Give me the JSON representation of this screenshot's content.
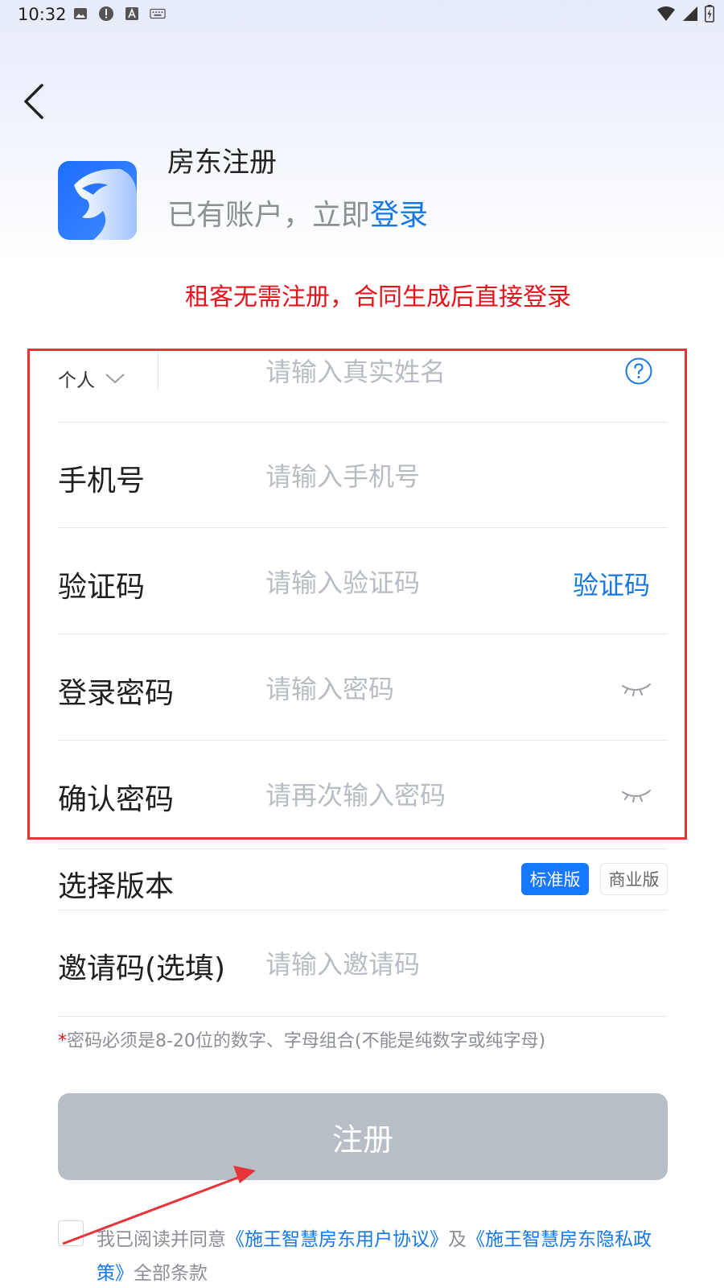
{
  "status_bar": {
    "time": "10:32"
  },
  "header": {
    "title": "房东注册",
    "login_prompt": "已有账户，立即",
    "login_link": "登录"
  },
  "notice": "租客无需注册，合同生成后直接登录",
  "form": {
    "account_type": {
      "selected": "个人"
    },
    "name": {
      "placeholder": "请输入真实姓名"
    },
    "phone": {
      "label": "手机号",
      "placeholder": "请输入手机号"
    },
    "code": {
      "label": "验证码",
      "placeholder": "请输入验证码",
      "button": "验证码"
    },
    "password": {
      "label": "登录密码",
      "placeholder": "请输入密码"
    },
    "confirm_password": {
      "label": "确认密码",
      "placeholder": "请再次输入密码"
    },
    "edition": {
      "label": "选择版本",
      "options": [
        "标准版",
        "商业版"
      ],
      "selected": "标准版"
    },
    "invite": {
      "label": "邀请码(选填)",
      "placeholder": "请输入邀请码"
    },
    "password_hint": "密码必须是8-20位的数字、字母组合(不能是纯数字或纯字母)",
    "required_mark": "*"
  },
  "register_button": "注册",
  "agreement": {
    "prefix": "我已阅读并同意",
    "user_agreement": "《施王智慧房东用户协议》",
    "and": "及",
    "privacy_policy": "《施王智慧房东隐私政策》",
    "suffix": "全部条款"
  },
  "colors": {
    "accent": "#1677e5",
    "notice_red": "#e6121b",
    "button_disabled": "#b8bec6",
    "annotation_red": "#e5353b"
  }
}
